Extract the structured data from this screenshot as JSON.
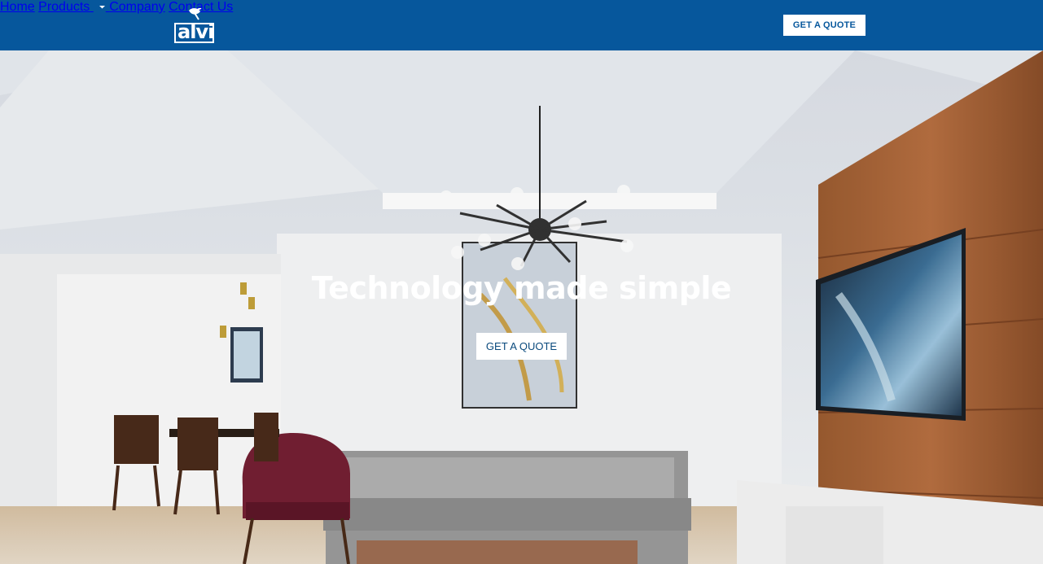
{
  "brand": {
    "logo_text": "alvi",
    "color": "#06579c"
  },
  "nav": {
    "home": "Home",
    "products": "Products",
    "company": "Company",
    "contact": "Contact Us",
    "quote_button": "GET A QUOTE"
  },
  "hero": {
    "headline": "Technology made simple",
    "cta": "GET A QUOTE"
  },
  "icons": {
    "dropdown": "chevron-down-icon",
    "logo_mark": "satellite-dish-icon"
  },
  "colors": {
    "header": "#06579c",
    "button_text": "#06579c",
    "button_bg": "#ffffff"
  }
}
